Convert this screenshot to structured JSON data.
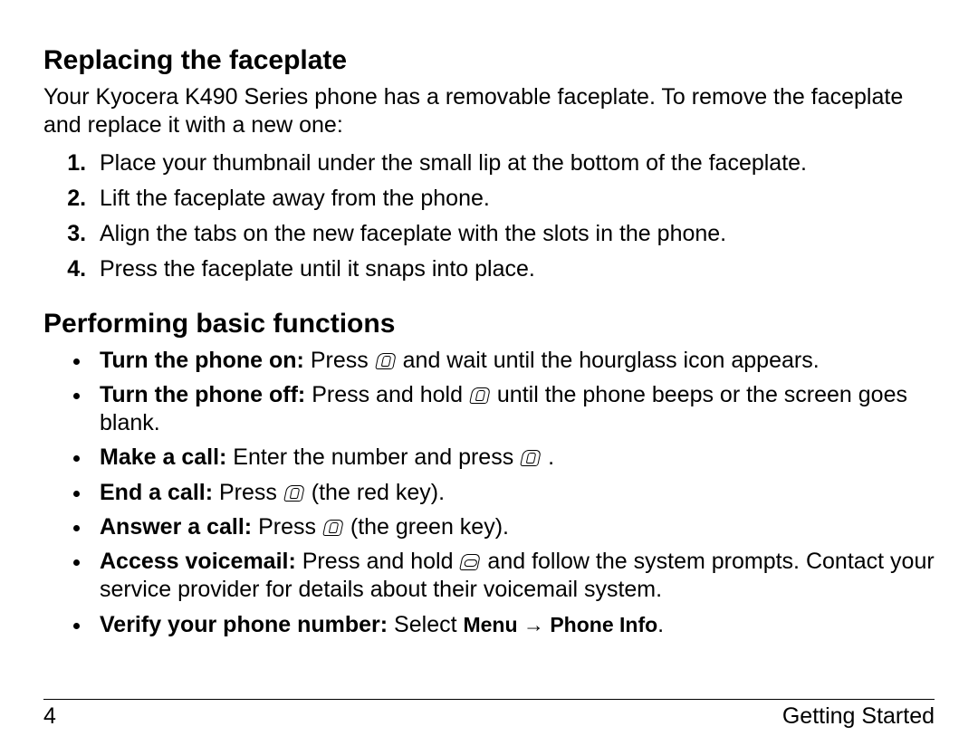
{
  "section1": {
    "heading": "Replacing the faceplate",
    "intro": "Your Kyocera K490 Series phone has a removable faceplate. To remove the faceplate and replace it with a new one:",
    "steps": [
      "Place your thumbnail under the small lip at the bottom of the faceplate.",
      "Lift the faceplate away from the phone.",
      "Align the tabs on the new faceplate with the slots in the phone.",
      "Press the faceplate until it snaps into place."
    ]
  },
  "section2": {
    "heading": "Performing basic functions",
    "items": [
      {
        "label": "Turn the phone on:",
        "before": " Press ",
        "icon": "end-key-icon",
        "after": " and wait until the hourglass icon appears."
      },
      {
        "label": "Turn the phone off:",
        "before": " Press and hold ",
        "icon": "end-key-icon",
        "after": " until the phone beeps or the screen goes blank."
      },
      {
        "label": "Make a call:",
        "before": " Enter the number and press ",
        "icon": "talk-key-icon",
        "after": " ."
      },
      {
        "label": "End a call:",
        "before": " Press ",
        "icon": "end-key-icon",
        "after": " (the red key)."
      },
      {
        "label": "Answer a call:",
        "before": " Press ",
        "icon": "talk-key-icon",
        "after": " (the green key)."
      },
      {
        "label": "Access voicemail:",
        "before": " Press and hold ",
        "icon": "voicemail-key-icon",
        "after": " and follow the system prompts. Contact your service provider for details about their voicemail system."
      },
      {
        "label": "Verify your phone number:",
        "before": " Select ",
        "menu_a": "Menu",
        "arrow": " → ",
        "menu_b": "Phone Info",
        "after2": "."
      }
    ]
  },
  "footer": {
    "page": "4",
    "section": "Getting Started"
  }
}
